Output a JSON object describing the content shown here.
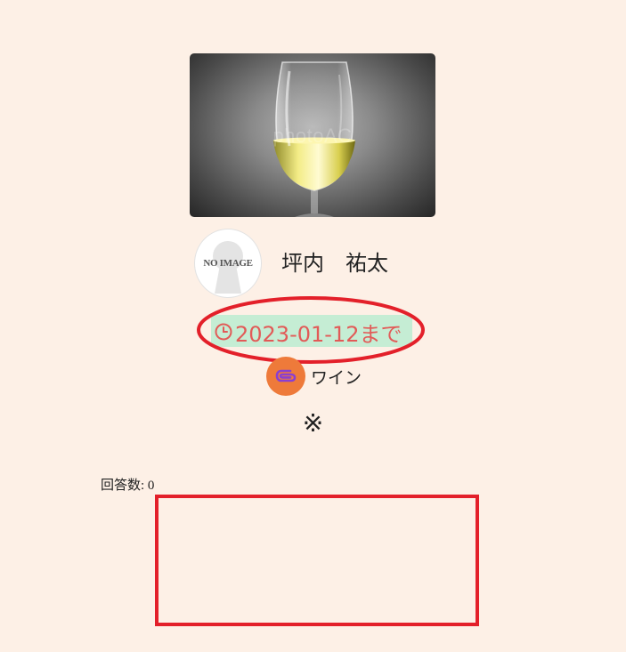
{
  "hero": {
    "image_alt": "wine glass photo",
    "watermark": "photoAC"
  },
  "author": {
    "avatar_text": "NO IMAGE",
    "name": "坪内　祐太"
  },
  "deadline": {
    "icon": "clock-icon",
    "text": "2023-01-12まで",
    "text_color": "#e25a57",
    "highlight_color": "#c5edd4",
    "annotation_color": "#e3202a"
  },
  "category": {
    "icon": "paperclip-icon",
    "label": "ワイン",
    "icon_bg": "#ee7a3a"
  },
  "note": "※",
  "answers": {
    "label": "回答数: 0"
  }
}
